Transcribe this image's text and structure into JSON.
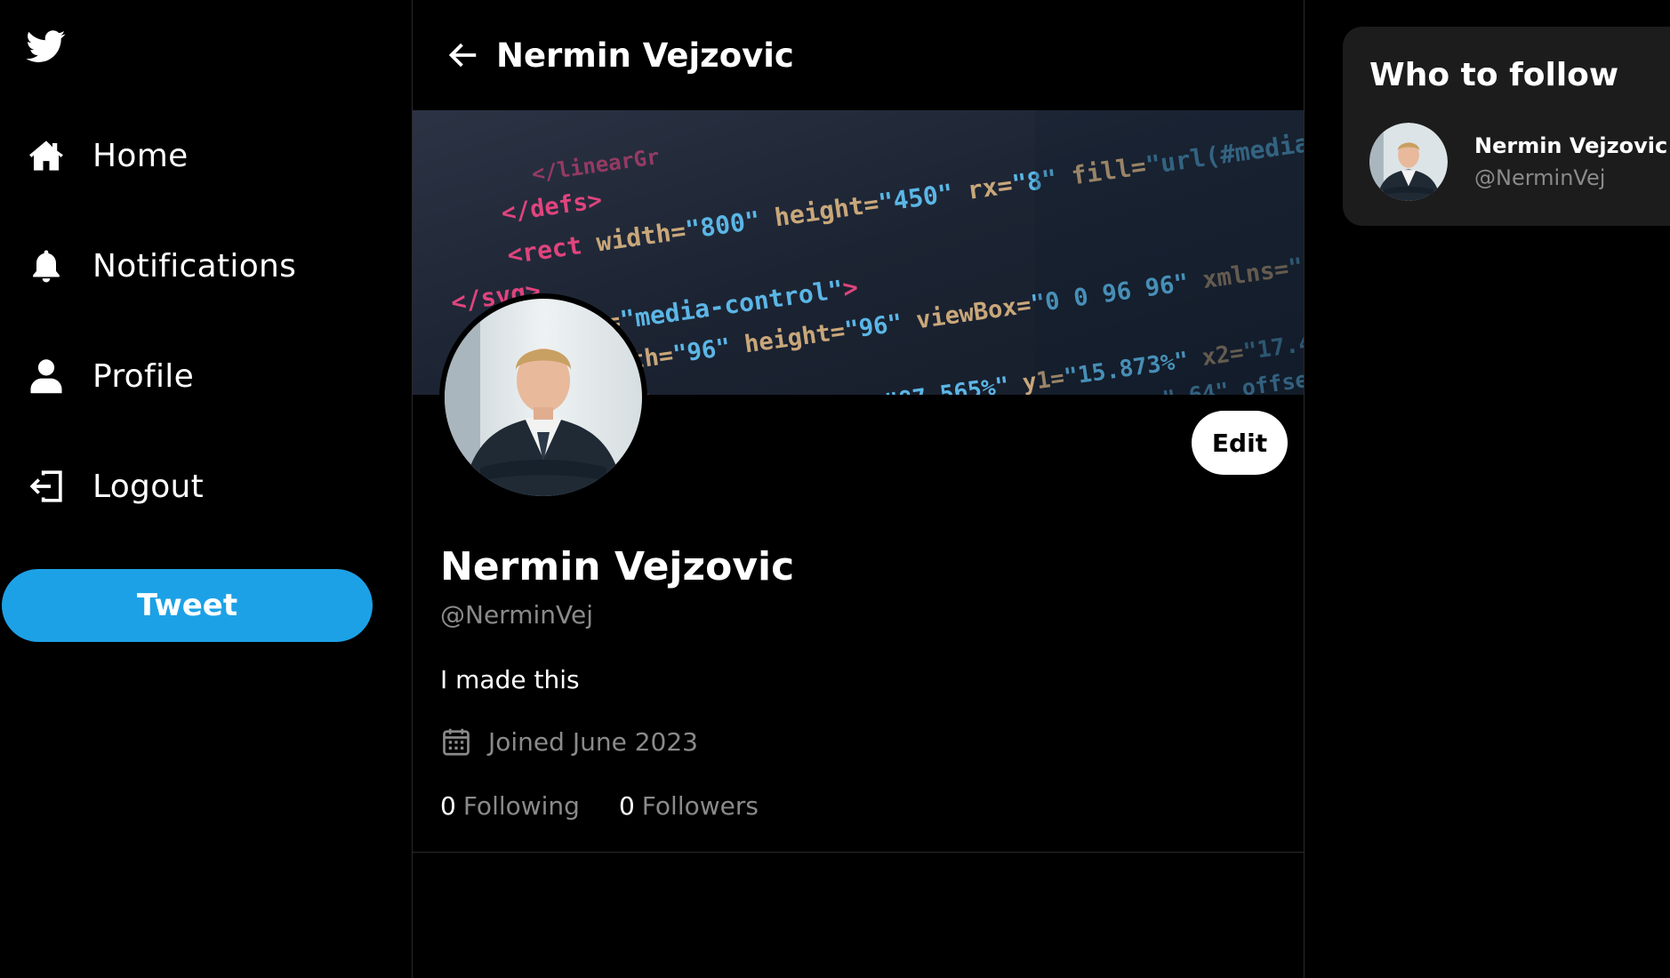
{
  "sidebar": {
    "logo_icon": "twitter-bird-icon",
    "items": [
      {
        "label": "Home",
        "icon": "home-icon"
      },
      {
        "label": "Notifications",
        "icon": "bell-icon"
      },
      {
        "label": "Profile",
        "icon": "user-icon"
      },
      {
        "label": "Logout",
        "icon": "logout-icon"
      }
    ],
    "tweet_label": "Tweet"
  },
  "header": {
    "title": "Nermin Vejzovic",
    "back_icon": "arrow-left-icon"
  },
  "profile": {
    "name": "Nermin Vejzovic",
    "handle": "@NerminVej",
    "bio": "I made this",
    "joined": "Joined June 2023",
    "edit_label": "Edit",
    "following_count": "0",
    "following_label": "Following",
    "followers_count": "0",
    "followers_label": "Followers"
  },
  "who_to_follow": {
    "title": "Who to follow",
    "users": [
      {
        "name": "Nermin Vejzovic",
        "handle": "@NerminVej"
      }
    ]
  },
  "colors": {
    "background": "#000000",
    "accent": "#1da1e6",
    "muted_text": "#8a8a8a",
    "panel": "#1c1c1c"
  }
}
